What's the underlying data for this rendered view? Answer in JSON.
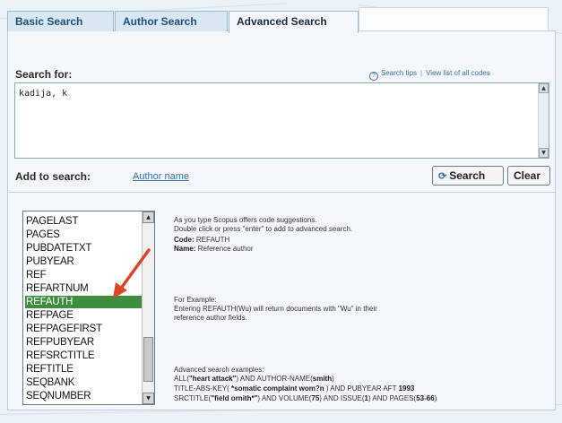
{
  "tabs": [
    {
      "label": "Basic Search"
    },
    {
      "label": "Author Search"
    },
    {
      "label": "Advanced Search"
    }
  ],
  "search": {
    "label": "Search for:",
    "value": "kadija, k",
    "tips_link": "Search tips",
    "codes_link": "View list of all codes"
  },
  "add_to_search": {
    "label": "Add to search:",
    "link": "Author name"
  },
  "buttons": {
    "search": "Search",
    "clear": "Clear"
  },
  "code_list": {
    "items": [
      "PAGELAST",
      "PAGES",
      "PUBDATETXT",
      "PUBYEAR",
      "REF",
      "REFARTNUM",
      "REFAUTH",
      "REFPAGE",
      "REFPAGEFIRST",
      "REFPUBYEAR",
      "REFSRCTITLE",
      "REFTITLE",
      "SEQBANK",
      "SEQNUMBER"
    ],
    "selected": "REFAUTH"
  },
  "help": {
    "intro_line1": "As you type Scopus offers code suggestions.",
    "intro_line2": "Double click or press \"enter\" to add to advanced search.",
    "code_label": "Code:",
    "code_value": "REFAUTH",
    "name_label": "Name:",
    "name_value": "Reference author",
    "example_label": "For Example:",
    "example_line1": "Entering REFAUTH(Wu) will return documents with \"Wu\" in their",
    "example_line2": "reference author fields.",
    "adv_label": "Advanced search examples:",
    "adv_ex1_a": "ALL(",
    "adv_ex1_b": "\"heart attack\"",
    "adv_ex1_c": ") AND AUTHOR-NAME(",
    "adv_ex1_d": "smith",
    "adv_ex1_e": ")",
    "adv_ex2_a": "TITLE-ABS-KEY(",
    "adv_ex2_b": " *somatic complaint wom?n ",
    "adv_ex2_c": ") AND PUBYEAR AFT ",
    "adv_ex2_d": "1993",
    "adv_ex3_a": "SRCTITLE(",
    "adv_ex3_b": "\"field ornith*\"",
    "adv_ex3_c": ") AND VOLUME(",
    "adv_ex3_d": "75",
    "adv_ex3_e": ") AND ISSUE(",
    "adv_ex3_f": "1",
    "adv_ex3_g": ") AND PAGES(",
    "adv_ex3_h": "53-66",
    "adv_ex3_i": ")"
  },
  "colors": {
    "accent": "#3d72a6",
    "selection": "#3d8d3f",
    "arrow": "#d9462a"
  }
}
